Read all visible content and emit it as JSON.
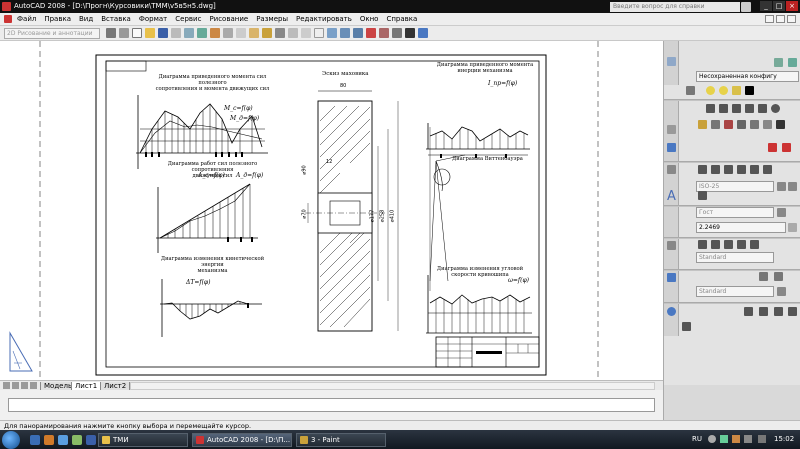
{
  "window": {
    "title": "AutoCAD 2008 - [D:\\Прогн\\Курсовики\\ТММ\\v5в5н5.dwg]",
    "help_placeholder": "Введите вопрос для справки"
  },
  "menu": [
    "Файл",
    "Правка",
    "Вид",
    "Вставка",
    "Формат",
    "Сервис",
    "Рисование",
    "Размеры",
    "Редактировать",
    "Окно",
    "Справка"
  ],
  "toolbar": {
    "workspace": "2D Рисование и аннотации"
  },
  "drawing": {
    "titles": {
      "t1a": "Диаграмма приведенного момента сил полезного",
      "t1b": "сопротивления и момента движущих сил",
      "t2a": "Диаграмма работ сил полезного сопротивления",
      "t2b": "движущих сил",
      "t3a": "Диаграмма изменения кинетической энергии",
      "t3b": "механизма",
      "t4": "Эскиз маховика",
      "t5a": "Диаграмма приведенного момента",
      "t5b": "инерции механизма",
      "t6": "Диаграмма Виттенбауэра",
      "t7a": "Диаграмма изменения угловой",
      "t7b": "скорости кривошипа"
    },
    "labels": {
      "m_c": "M_c=f(φ)",
      "m_d": "M_д=f(φ)",
      "a_c": "A_c=f(φ)",
      "a_d": "A_д=f(φ)",
      "delta_t": "ΔT=f(φ)",
      "i_pr": "I_пр=f(φ)",
      "omega": "ω=f(φ)",
      "dim_80": "80",
      "dim_12": "12",
      "dim_d90": "⌀90",
      "dim_d70": "⌀70",
      "dim_d177": "⌀177",
      "dim_d258": "⌀258",
      "dim_d410": "⌀410"
    }
  },
  "layout_tabs": [
    "Модель",
    "Лист1",
    "Лист2"
  ],
  "ribbon": {
    "layer": "Несохраненная конфигу",
    "dimstyle": "ISO-25",
    "textstyle": "Гост",
    "textheight": "2.2469",
    "multileader": "Standard",
    "tablestyle": "Standard",
    "label_A": "A"
  },
  "status": "Для панорамирования нажмите кнопку выбора и перемещайте курсор.",
  "taskbar": {
    "tasks": [
      "ТМИ",
      "AutoCAD 2008 - [D:\\П...",
      "3 - Paint"
    ],
    "lang": "RU",
    "clock": "15:02"
  }
}
